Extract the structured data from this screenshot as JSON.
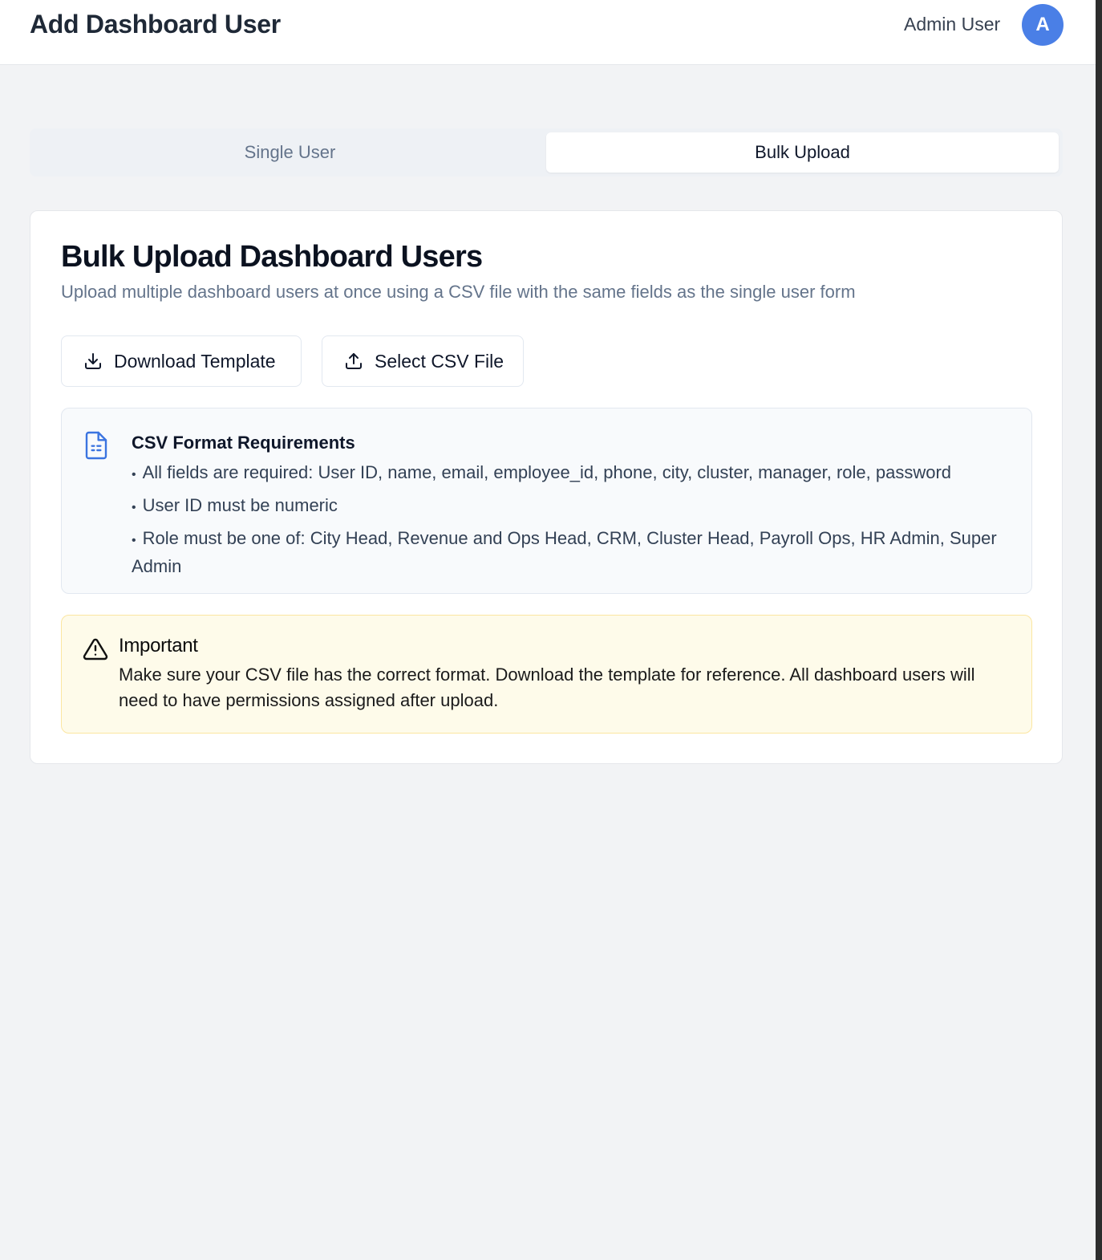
{
  "header": {
    "title": "Add Dashboard User",
    "user_name": "Admin User",
    "avatar_initial": "A"
  },
  "tabs": [
    {
      "label": "Single User",
      "active": false
    },
    {
      "label": "Bulk Upload",
      "active": true
    }
  ],
  "card": {
    "title": "Bulk Upload Dashboard Users",
    "subtitle": "Upload multiple dashboard users at once using a CSV file with the same fields as the single user form",
    "buttons": {
      "download": {
        "label": "Download Template",
        "icon": "download-icon"
      },
      "select": {
        "label": "Select CSV File",
        "icon": "upload-icon"
      }
    },
    "requirements": {
      "icon": "file-spreadsheet-icon",
      "title": "CSV Format Requirements",
      "items": [
        "All fields are required: User ID, name, email, employee_id, phone, city, cluster, manager, role, password",
        "User ID must be numeric",
        "Role must be one of: City Head, Revenue and Ops Head, CRM, Cluster Head, Payroll Ops, HR Admin, Super Admin"
      ]
    },
    "warning": {
      "icon": "alert-triangle-icon",
      "title": "Important",
      "text": "Make sure your CSV file has the correct format. Download the template for reference. All dashboard users will need to have permissions assigned after upload."
    }
  },
  "colors": {
    "accent": "#4a7fe6",
    "page_bg": "#f2f3f5",
    "warning_bg": "#fefbea",
    "warning_border": "#fbe6a1"
  }
}
